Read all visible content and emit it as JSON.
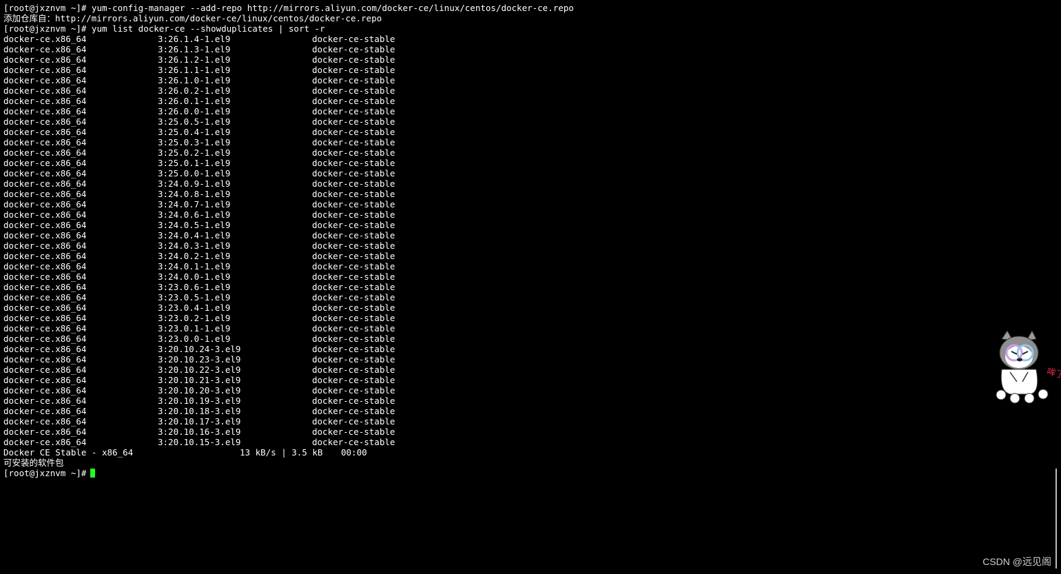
{
  "terminal": {
    "prompt": "[root@jxznvm ~]#",
    "lines": [
      {
        "type": "cmd",
        "text": "[root@jxznvm ~]# yum-config-manager --add-repo http://mirrors.aliyun.com/docker-ce/linux/centos/docker-ce.repo"
      },
      {
        "type": "text",
        "text": "添加仓库自：http://mirrors.aliyun.com/docker-ce/linux/centos/docker-ce.repo"
      },
      {
        "type": "cmd",
        "text": "[root@jxznvm ~]# yum list docker-ce --showduplicates | sort -r"
      }
    ],
    "packages": [
      {
        "name": "docker-ce.x86_64",
        "version": "3:26.1.4-1.el9",
        "repo": "docker-ce-stable"
      },
      {
        "name": "docker-ce.x86_64",
        "version": "3:26.1.3-1.el9",
        "repo": "docker-ce-stable"
      },
      {
        "name": "docker-ce.x86_64",
        "version": "3:26.1.2-1.el9",
        "repo": "docker-ce-stable"
      },
      {
        "name": "docker-ce.x86_64",
        "version": "3:26.1.1-1.el9",
        "repo": "docker-ce-stable"
      },
      {
        "name": "docker-ce.x86_64",
        "version": "3:26.1.0-1.el9",
        "repo": "docker-ce-stable"
      },
      {
        "name": "docker-ce.x86_64",
        "version": "3:26.0.2-1.el9",
        "repo": "docker-ce-stable"
      },
      {
        "name": "docker-ce.x86_64",
        "version": "3:26.0.1-1.el9",
        "repo": "docker-ce-stable"
      },
      {
        "name": "docker-ce.x86_64",
        "version": "3:26.0.0-1.el9",
        "repo": "docker-ce-stable"
      },
      {
        "name": "docker-ce.x86_64",
        "version": "3:25.0.5-1.el9",
        "repo": "docker-ce-stable"
      },
      {
        "name": "docker-ce.x86_64",
        "version": "3:25.0.4-1.el9",
        "repo": "docker-ce-stable"
      },
      {
        "name": "docker-ce.x86_64",
        "version": "3:25.0.3-1.el9",
        "repo": "docker-ce-stable"
      },
      {
        "name": "docker-ce.x86_64",
        "version": "3:25.0.2-1.el9",
        "repo": "docker-ce-stable"
      },
      {
        "name": "docker-ce.x86_64",
        "version": "3:25.0.1-1.el9",
        "repo": "docker-ce-stable"
      },
      {
        "name": "docker-ce.x86_64",
        "version": "3:25.0.0-1.el9",
        "repo": "docker-ce-stable"
      },
      {
        "name": "docker-ce.x86_64",
        "version": "3:24.0.9-1.el9",
        "repo": "docker-ce-stable"
      },
      {
        "name": "docker-ce.x86_64",
        "version": "3:24.0.8-1.el9",
        "repo": "docker-ce-stable"
      },
      {
        "name": "docker-ce.x86_64",
        "version": "3:24.0.7-1.el9",
        "repo": "docker-ce-stable"
      },
      {
        "name": "docker-ce.x86_64",
        "version": "3:24.0.6-1.el9",
        "repo": "docker-ce-stable"
      },
      {
        "name": "docker-ce.x86_64",
        "version": "3:24.0.5-1.el9",
        "repo": "docker-ce-stable"
      },
      {
        "name": "docker-ce.x86_64",
        "version": "3:24.0.4-1.el9",
        "repo": "docker-ce-stable"
      },
      {
        "name": "docker-ce.x86_64",
        "version": "3:24.0.3-1.el9",
        "repo": "docker-ce-stable"
      },
      {
        "name": "docker-ce.x86_64",
        "version": "3:24.0.2-1.el9",
        "repo": "docker-ce-stable"
      },
      {
        "name": "docker-ce.x86_64",
        "version": "3:24.0.1-1.el9",
        "repo": "docker-ce-stable"
      },
      {
        "name": "docker-ce.x86_64",
        "version": "3:24.0.0-1.el9",
        "repo": "docker-ce-stable"
      },
      {
        "name": "docker-ce.x86_64",
        "version": "3:23.0.6-1.el9",
        "repo": "docker-ce-stable"
      },
      {
        "name": "docker-ce.x86_64",
        "version": "3:23.0.5-1.el9",
        "repo": "docker-ce-stable"
      },
      {
        "name": "docker-ce.x86_64",
        "version": "3:23.0.4-1.el9",
        "repo": "docker-ce-stable"
      },
      {
        "name": "docker-ce.x86_64",
        "version": "3:23.0.2-1.el9",
        "repo": "docker-ce-stable"
      },
      {
        "name": "docker-ce.x86_64",
        "version": "3:23.0.1-1.el9",
        "repo": "docker-ce-stable"
      },
      {
        "name": "docker-ce.x86_64",
        "version": "3:23.0.0-1.el9",
        "repo": "docker-ce-stable"
      },
      {
        "name": "docker-ce.x86_64",
        "version": "3:20.10.24-3.el9",
        "repo": "docker-ce-stable"
      },
      {
        "name": "docker-ce.x86_64",
        "version": "3:20.10.23-3.el9",
        "repo": "docker-ce-stable"
      },
      {
        "name": "docker-ce.x86_64",
        "version": "3:20.10.22-3.el9",
        "repo": "docker-ce-stable"
      },
      {
        "name": "docker-ce.x86_64",
        "version": "3:20.10.21-3.el9",
        "repo": "docker-ce-stable"
      },
      {
        "name": "docker-ce.x86_64",
        "version": "3:20.10.20-3.el9",
        "repo": "docker-ce-stable"
      },
      {
        "name": "docker-ce.x86_64",
        "version": "3:20.10.19-3.el9",
        "repo": "docker-ce-stable"
      },
      {
        "name": "docker-ce.x86_64",
        "version": "3:20.10.18-3.el9",
        "repo": "docker-ce-stable"
      },
      {
        "name": "docker-ce.x86_64",
        "version": "3:20.10.17-3.el9",
        "repo": "docker-ce-stable"
      },
      {
        "name": "docker-ce.x86_64",
        "version": "3:20.10.16-3.el9",
        "repo": "docker-ce-stable"
      },
      {
        "name": "docker-ce.x86_64",
        "version": "3:20.10.15-3.el9",
        "repo": "docker-ce-stable"
      }
    ],
    "repo_status": {
      "name": "Docker CE Stable - x86_64",
      "speed": "13 kB/s | 3.5 kB",
      "time": "00:00"
    },
    "available_label": "可安装的软件包"
  },
  "colors": {
    "background": "#000000",
    "text": "#ffffff",
    "cursor": "#22ff22"
  },
  "watermark": "CSDN @远见阁",
  "sticker": {
    "icon": "husky-mascot-icon",
    "text": "哞了"
  }
}
